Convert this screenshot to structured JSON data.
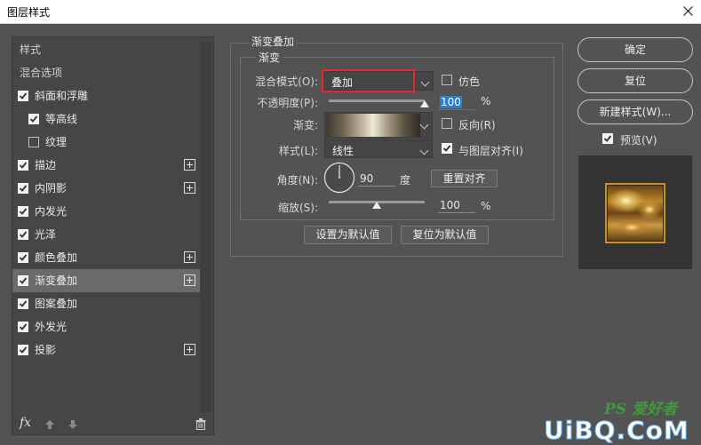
{
  "window": {
    "title": "图层样式"
  },
  "left_panel": {
    "section_styles": "样式",
    "section_blend": "混合选项",
    "items": [
      {
        "label": "斜面和浮雕",
        "checked": true,
        "plus": false,
        "indent": false
      },
      {
        "label": "等高线",
        "checked": true,
        "plus": false,
        "indent": true
      },
      {
        "label": "纹理",
        "checked": false,
        "plus": false,
        "indent": true
      },
      {
        "label": "描边",
        "checked": true,
        "plus": true,
        "indent": false
      },
      {
        "label": "内阴影",
        "checked": true,
        "plus": true,
        "indent": false
      },
      {
        "label": "内发光",
        "checked": true,
        "plus": false,
        "indent": false
      },
      {
        "label": "光泽",
        "checked": true,
        "plus": false,
        "indent": false
      },
      {
        "label": "颜色叠加",
        "checked": true,
        "plus": true,
        "indent": false
      },
      {
        "label": "渐变叠加",
        "checked": true,
        "plus": true,
        "indent": false,
        "selected": true
      },
      {
        "label": "图案叠加",
        "checked": true,
        "plus": false,
        "indent": false
      },
      {
        "label": "外发光",
        "checked": true,
        "plus": false,
        "indent": false
      },
      {
        "label": "投影",
        "checked": true,
        "plus": true,
        "indent": false
      }
    ],
    "fx_label": "fx"
  },
  "main": {
    "group_title": "渐变叠加",
    "sub_title": "渐变",
    "blend_mode_label": "混合模式(O):",
    "blend_mode_value": "叠加",
    "dither_label": "仿色",
    "dither_checked": false,
    "opacity_label": "不透明度(P):",
    "opacity_value": "100",
    "opacity_unit": "%",
    "opacity_level": 1.0,
    "gradient_label": "渐变:",
    "reverse_label": "反向(R)",
    "reverse_checked": false,
    "style_label": "样式(L):",
    "style_value": "线性",
    "align_label": "与图层对齐(I)",
    "align_checked": true,
    "angle_label": "角度(N):",
    "angle_value": "90",
    "angle_unit": "度",
    "reset_align_label": "重置对齐",
    "scale_label": "缩放(S):",
    "scale_value": "100",
    "scale_unit": "%",
    "scale_level": 0.5,
    "set_default_label": "设置为默认值",
    "reset_default_label": "复位为默认值"
  },
  "right": {
    "ok_label": "确定",
    "reset_label": "复位",
    "new_style_label": "新建样式(W)...",
    "preview_label": "预览(V)",
    "preview_checked": true
  },
  "watermark": {
    "top": "PS 爱好者",
    "bottom": "UiBQ.CoM"
  },
  "colors": {
    "highlight_red": "#e8262d",
    "selected_row": "#6a6a6a",
    "focus_blue": "#2a7fd4"
  }
}
